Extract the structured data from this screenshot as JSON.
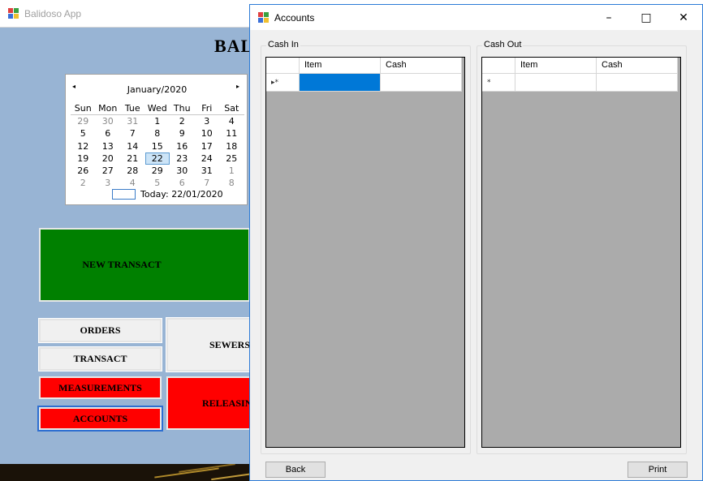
{
  "main_window": {
    "title": "Balidoso App",
    "heading": "BAL",
    "calendar": {
      "month_label": "January/2020",
      "prev_icon": "◂",
      "next_icon": "▸",
      "days_of_week": [
        "Sun",
        "Mon",
        "Tue",
        "Wed",
        "Thu",
        "Fri",
        "Sat"
      ],
      "weeks": [
        [
          "29",
          "30",
          "31",
          "1",
          "2",
          "3",
          "4"
        ],
        [
          "5",
          "6",
          "7",
          "8",
          "9",
          "10",
          "11"
        ],
        [
          "12",
          "13",
          "14",
          "15",
          "16",
          "17",
          "18"
        ],
        [
          "19",
          "20",
          "21",
          "22",
          "23",
          "24",
          "25"
        ],
        [
          "26",
          "27",
          "28",
          "29",
          "30",
          "31",
          "1"
        ],
        [
          "2",
          "3",
          "4",
          "5",
          "6",
          "7",
          "8"
        ]
      ],
      "selected_day": "22",
      "today_label": "Today: 22/01/2020"
    },
    "buttons": {
      "new_transact": "NEW TRANSACT",
      "orders": "ORDERS",
      "transact": "TRANSACT",
      "sewers": "SEWERS",
      "measurements": "MEASUREMENTS",
      "accounts": "ACCOUNTS",
      "releasing": "RELEASIN"
    }
  },
  "accounts_window": {
    "title": "Accounts",
    "controls": {
      "minimize": "–",
      "maximize": "□",
      "close": "✕"
    },
    "cash_in": {
      "label": "Cash In",
      "columns": [
        "Item",
        "Cash"
      ],
      "new_row_marker": "▸*"
    },
    "cash_out": {
      "label": "Cash Out",
      "columns": [
        "Item",
        "Cash"
      ],
      "new_row_marker": "*"
    },
    "back_button": "Back",
    "print_button": "Print"
  },
  "colors": {
    "main_background": "#98b4d4",
    "button_red": "#ff0000",
    "button_green": "#008000",
    "grid_background": "#ababab",
    "selection_blue": "#0078d7"
  }
}
